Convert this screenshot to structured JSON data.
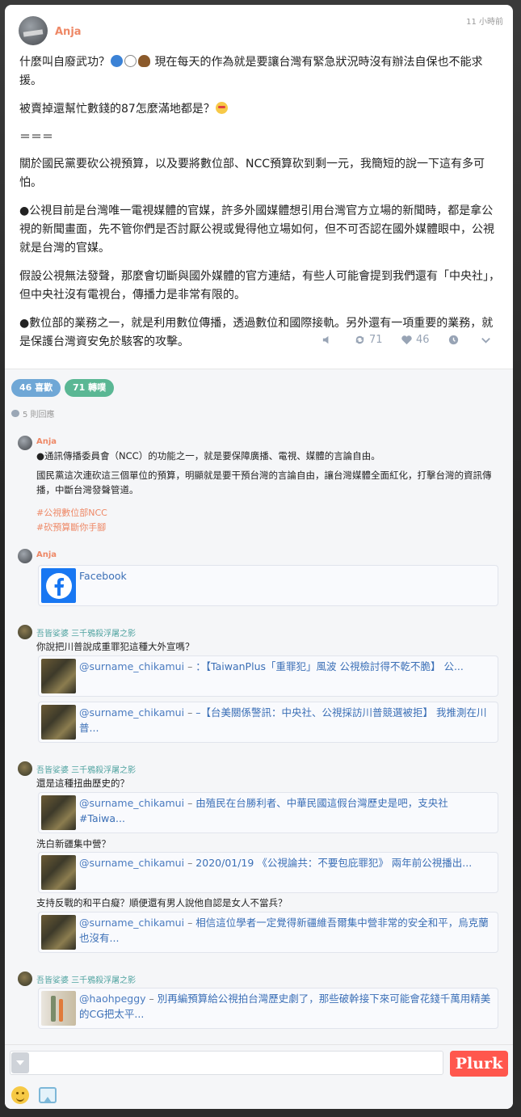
{
  "plurk": {
    "author": "Anja",
    "time": "11 小時前",
    "paragraphs": {
      "p1_a": "什麼叫自廢武功？",
      "p1_b": "現在每天的作為就是要讓台灣有緊急狀況時沒有辦法自保也不能求援。",
      "p2": "被賣掉還幫忙數錢的87怎麼滿地都是？",
      "p3": "＝＝＝",
      "p4": "關於國民黨要砍公視預算，以及要將數位部、NCC預算砍到剩一元，我簡短的說一下這有多可怕。",
      "p5": "●公視目前是台灣唯一電視媒體的官媒，許多外國媒體想引用台灣官方立場的新聞時，都是拿公視的新聞畫面，先不管你們是否討厭公視或覺得他立場如何，但不可否認在國外媒體眼中，公視就是台灣的官媒。",
      "p6": "假設公視無法發聲，那麼會切斷與國外媒體的官方連結，有些人可能會提到我們還有「中央社」，但中央社沒有電視台，傳播力是非常有限的。",
      "p7": "●數位部的業務之一，就是利用數位傳播，透過數位和國際接軌。另外還有一項重要的業務，就是保護台灣資安免於駭客的攻擊。"
    },
    "emoji": [
      "blue-circle",
      "white-circle",
      "poo"
    ],
    "emoji_star": "star-struck",
    "actions": {
      "replurks": "71",
      "likes": "46"
    }
  },
  "summary": {
    "likes_badge": "46 喜歡",
    "replurks_badge": "71 轉噗",
    "responses": "5 則回應"
  },
  "responses": [
    {
      "author": "Anja",
      "lines": [
        "●通訊傳播委員會（NCC）的功能之一，就是要保障廣播、電視、媒體的言論自由。",
        "國民黨這次連砍這三個單位的預算，明顯就是要干預台灣的言論自由，讓台灣媒體全面紅化，打擊台灣的資訊傳播，中斷台灣發聲管道。"
      ],
      "tags": [
        "#公視數位部NCC",
        "#砍預算斷你手腳"
      ]
    },
    {
      "author": "Anja",
      "link": "Facebook"
    },
    {
      "author": "吾皆娑婆 三千鴉殺浮屠之影",
      "text": "你說把川普說成重罪犯這種大外宣嗎？",
      "links": [
        {
          "user": "@surname_chikamui",
          "text": "：【TaiwanPlus「重罪犯」風波 公視檢討得不乾不脆】 公..."
        },
        {
          "user": "@surname_chikamui",
          "text": "–【台美關係警訊：中央社、公視採訪川普競選被拒】 我推測在川普..."
        }
      ]
    },
    {
      "author": "吾皆娑婆 三千鴉殺浮屠之影",
      "blocks": [
        {
          "text": "還是這種扭曲歷史的？",
          "user": "@surname_chikamui",
          "link": "由殖民在台勝利者、中華民國這假台灣歷史是吧，支央社 #Taiwa..."
        },
        {
          "text": "洗白新疆集中營？",
          "user": "@surname_chikamui",
          "link": "2020/01/19 《公視論共：不要包庇罪犯》 兩年前公視播出..."
        },
        {
          "text": "支持反戰的和平白癡？順便還有男人說他自認是女人不當兵？",
          "user": "@surname_chikamui",
          "link": "相信這位學者一定覺得新疆維吾爾集中營非常的安全和平，烏克蘭也沒有..."
        }
      ]
    },
    {
      "author": "吾皆娑婆 三千鴉殺浮屠之影",
      "link_user": "@haohpeggy",
      "link_text": "別再編預算給公視拍台灣歷史劇了，那些破幹接下來可能會花錢千萬用精美的CG把太平..."
    }
  ],
  "composer": {
    "placeholder": "",
    "submit_label": "Plurk"
  },
  "colors": {
    "accent": "#ee8866",
    "plurk_button": "#ff574d",
    "likes_badge": "#6fa7d6",
    "replurks_badge": "#5ab794"
  }
}
